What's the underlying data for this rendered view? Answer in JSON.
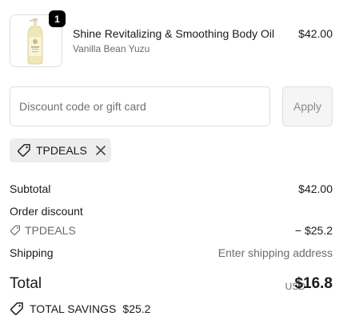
{
  "product": {
    "quantity": "1",
    "name": "Shine Revitalizing & Smoothing Body Oil",
    "variant": "Vanilla Bean Yuzu",
    "price": "$42.00"
  },
  "discount": {
    "placeholder": "Discount code or gift card",
    "apply_label": "Apply",
    "applied_code": "TPDEALS"
  },
  "summary": {
    "subtotal_label": "Subtotal",
    "subtotal_value": "$42.00",
    "order_discount_label": "Order discount",
    "discount_code": "TPDEALS",
    "discount_value": "− $25.2",
    "shipping_label": "Shipping",
    "shipping_value": "Enter shipping address",
    "total_label": "Total",
    "currency": "USD",
    "total_value": "$16.8",
    "savings_label": "TOTAL SAVINGS",
    "savings_value": "$25.2"
  },
  "icons": {
    "tag": "tag-icon",
    "close": "close-icon",
    "product_image": "body-oil-bottle-image"
  },
  "colors": {
    "badge": "#000000",
    "muted_text": "#6b6b6b",
    "chip_background": "#ededed",
    "apply_background": "#f5f5f5"
  }
}
